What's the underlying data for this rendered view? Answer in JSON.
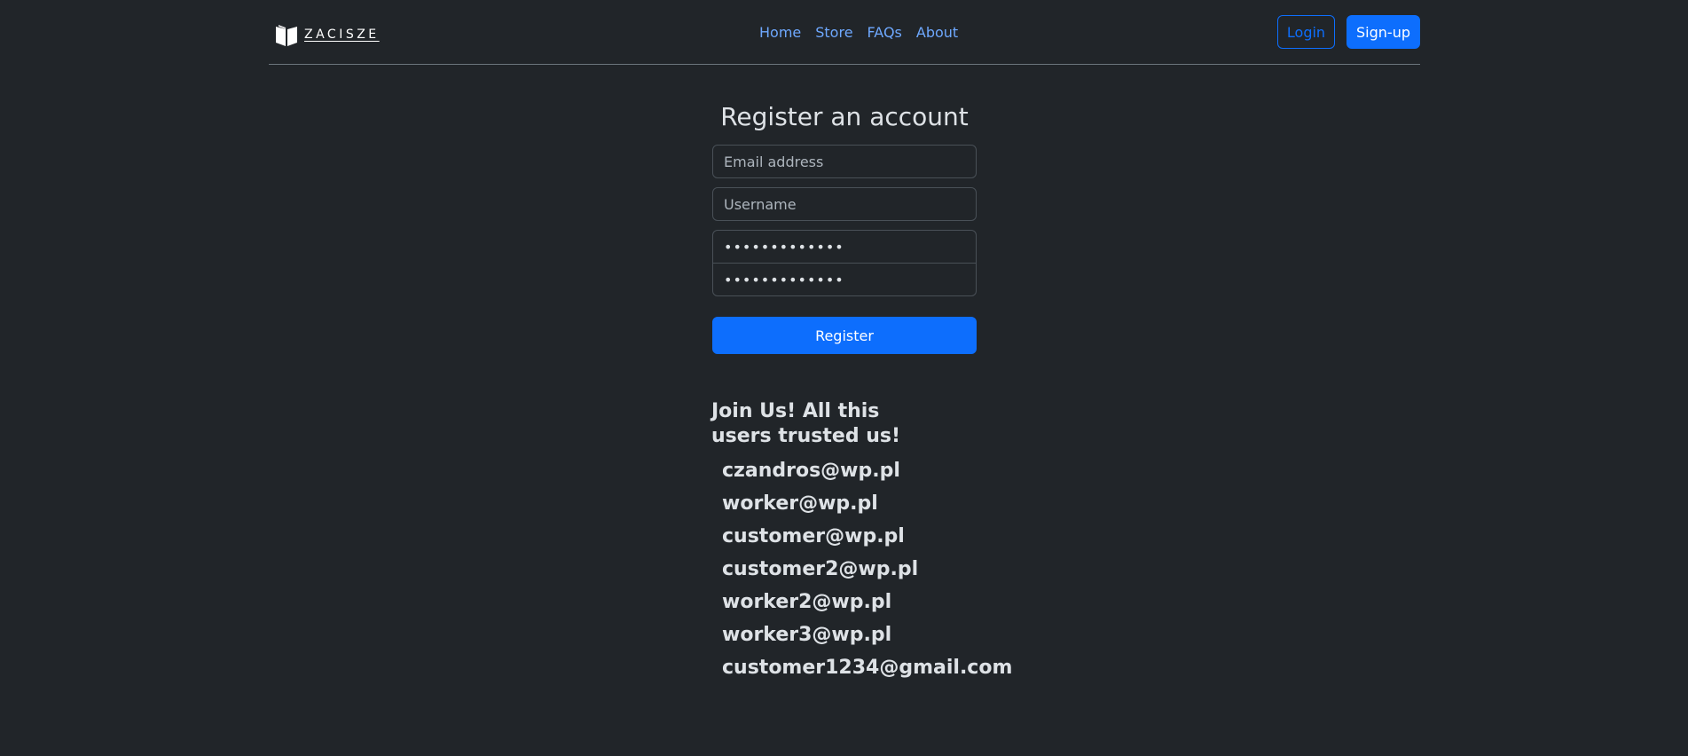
{
  "header": {
    "brand": {
      "name": "ZACISZE",
      "icon": "open-book-icon"
    },
    "nav": [
      {
        "label": "Home"
      },
      {
        "label": "Store"
      },
      {
        "label": "FAQs"
      },
      {
        "label": "About"
      }
    ],
    "login_label": "Login",
    "signup_label": "Sign-up"
  },
  "form": {
    "title": "Register an account",
    "email": {
      "placeholder": "Email address",
      "value": ""
    },
    "username": {
      "placeholder": "Username",
      "value": ""
    },
    "password": {
      "value": "•••••••••••••"
    },
    "confirm_password": {
      "value": "•••••••••••••"
    },
    "register_label": "Register"
  },
  "join": {
    "title": "Join Us! All this users trusted us!",
    "users": [
      "czandros@wp.pl",
      "worker@wp.pl",
      "customer@wp.pl",
      "customer2@wp.pl",
      "worker2@wp.pl",
      "worker3@wp.pl",
      "customer1234@gmail.com"
    ]
  },
  "colors": {
    "background": "#212529",
    "accent": "#0d6efd",
    "link": "#6ea8fe",
    "text": "#dee2e6",
    "border": "#495057"
  }
}
